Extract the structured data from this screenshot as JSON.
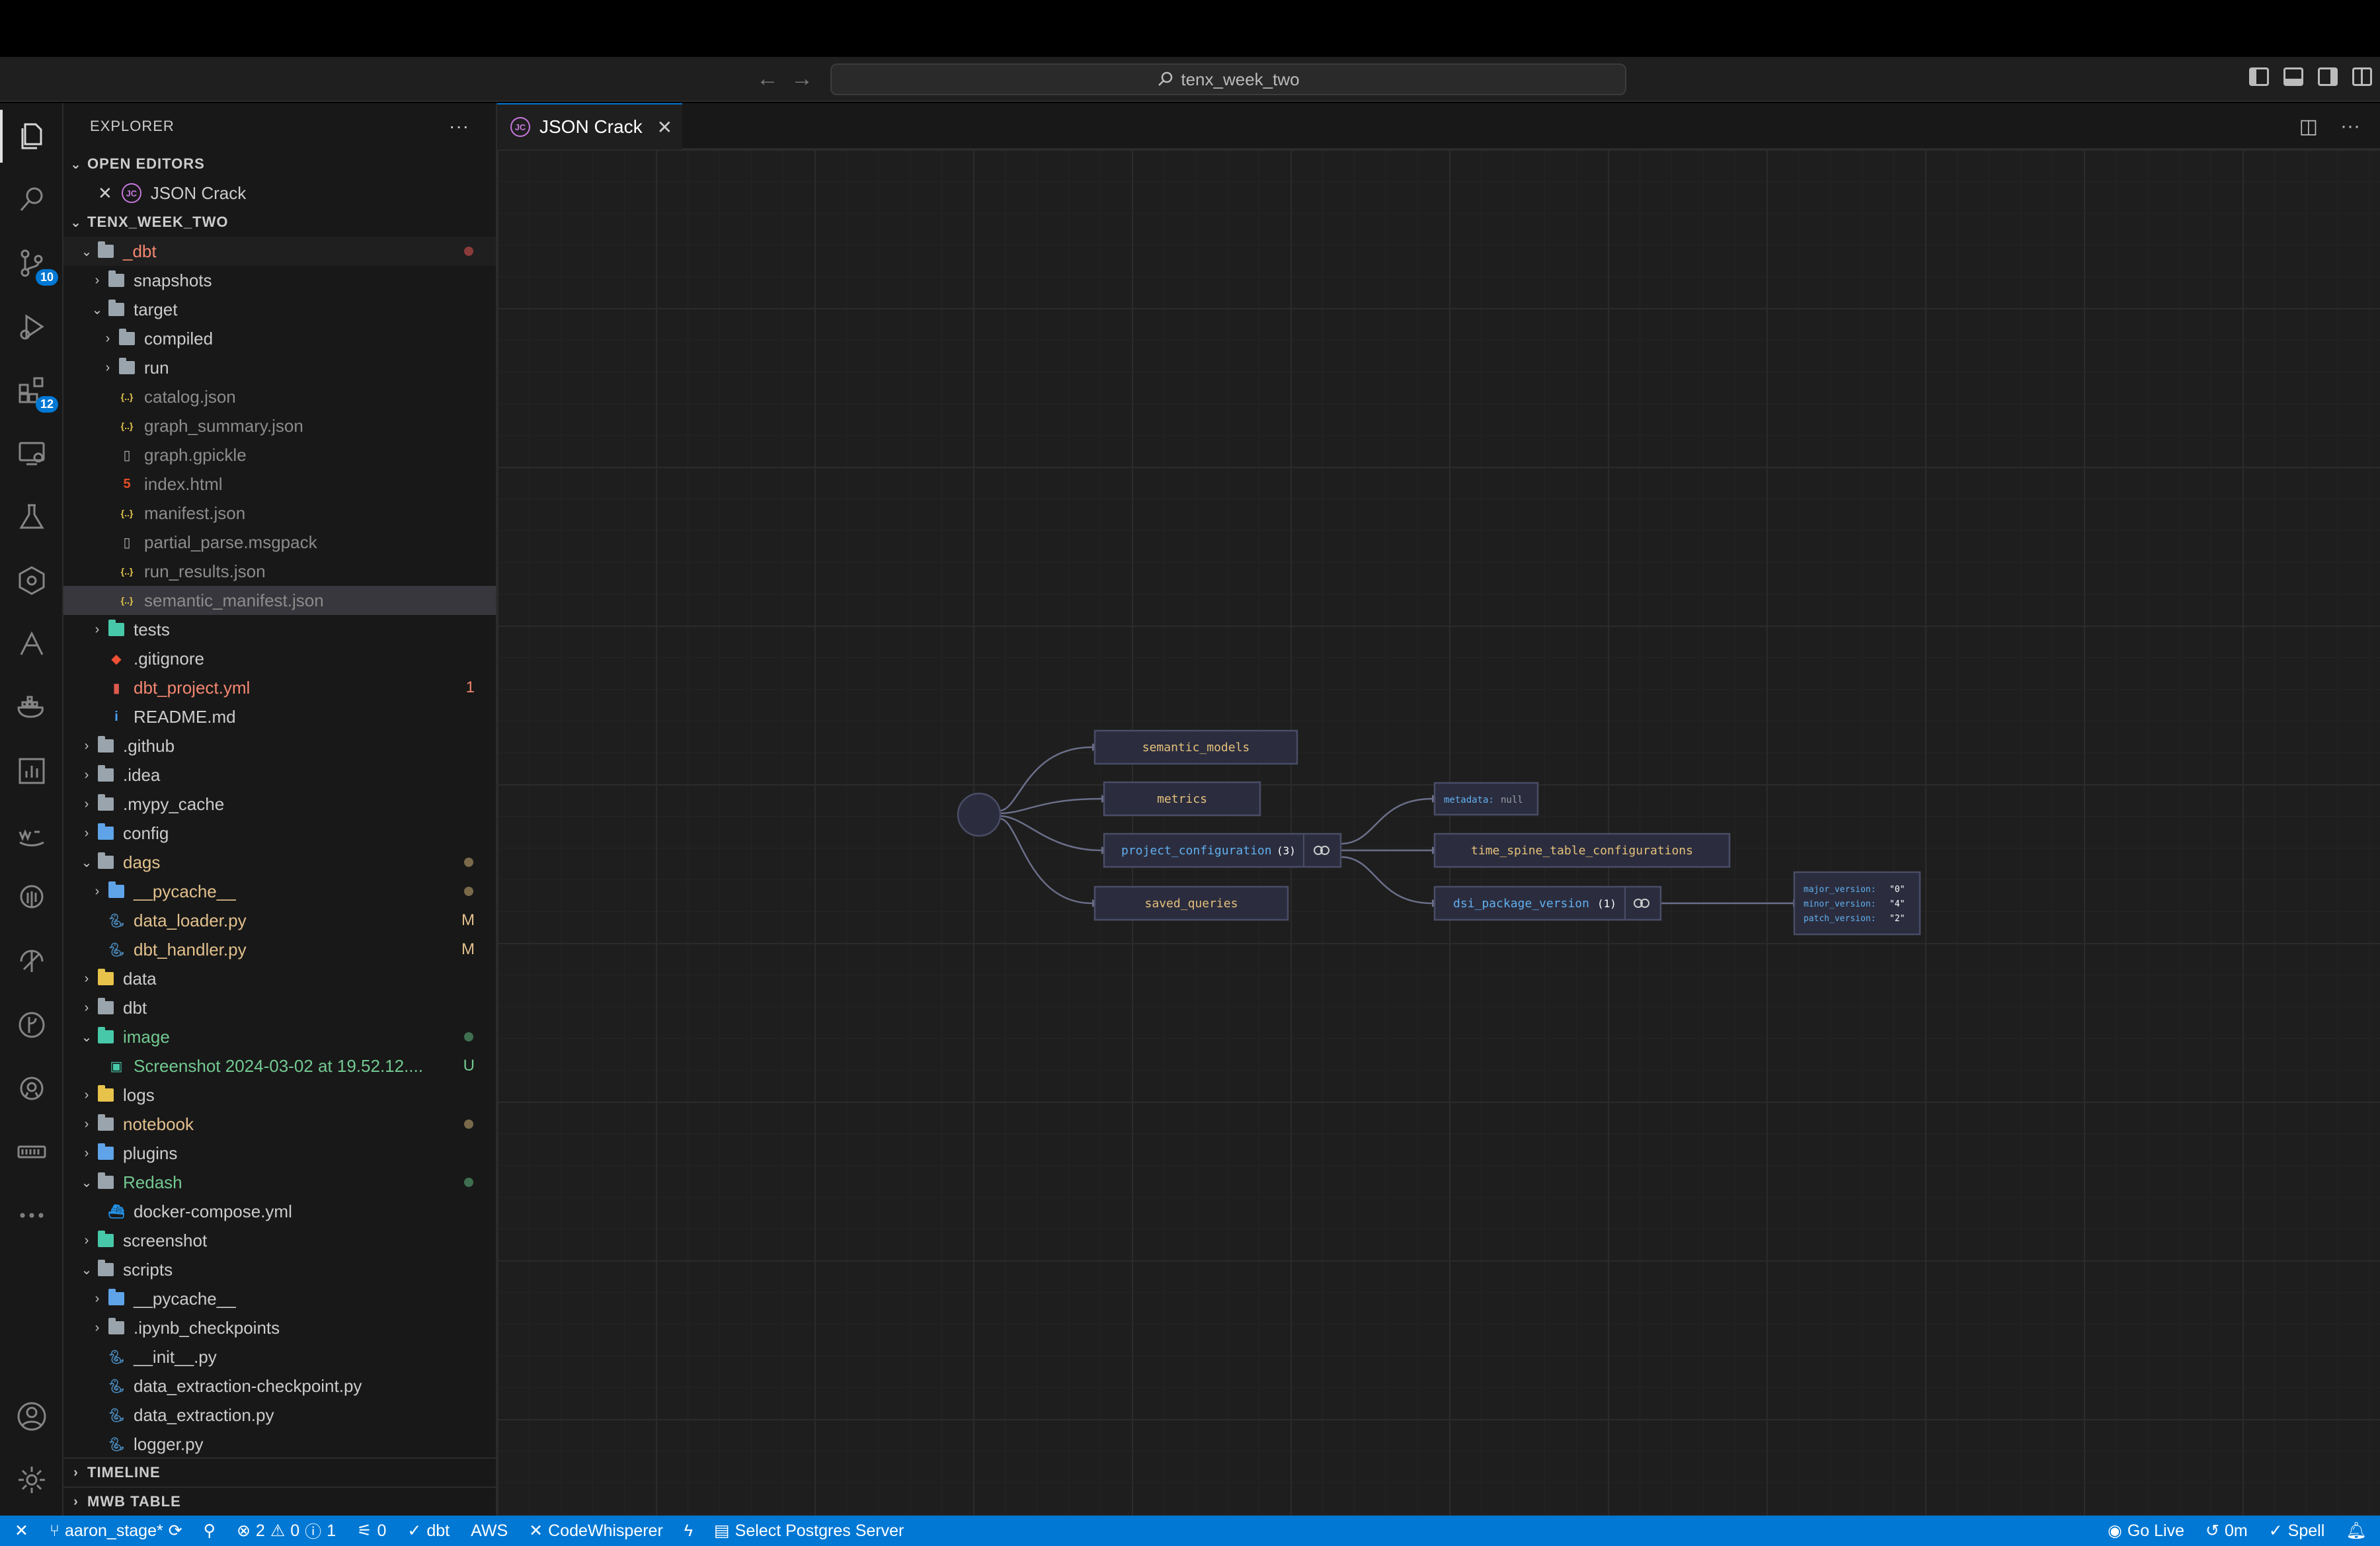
{
  "titlebar": {
    "search_text": "tenx_week_two"
  },
  "activity_badges": {
    "source_control": "10",
    "extensions": "12"
  },
  "sidebar": {
    "title": "EXPLORER",
    "more": "···",
    "open_editors_label": "OPEN EDITORS",
    "open_editor_item": "JSON Crack",
    "workspace_label": "TENX_WEEK_TWO",
    "rows": [
      {
        "label": "_dbt",
        "depth": 1,
        "kind": "folder-open",
        "color": "red",
        "status": "dot-red"
      },
      {
        "label": "snapshots",
        "depth": 2,
        "kind": "folder"
      },
      {
        "label": "target",
        "depth": 2,
        "kind": "folder-open"
      },
      {
        "label": "compiled",
        "depth": 3,
        "kind": "folder"
      },
      {
        "label": "run",
        "depth": 3,
        "kind": "folder"
      },
      {
        "label": "catalog.json",
        "depth": 3,
        "kind": "json",
        "color": "gray"
      },
      {
        "label": "graph_summary.json",
        "depth": 3,
        "kind": "json",
        "color": "gray"
      },
      {
        "label": "graph.gpickle",
        "depth": 3,
        "kind": "file",
        "color": "gray"
      },
      {
        "label": "index.html",
        "depth": 3,
        "kind": "html",
        "color": "gray"
      },
      {
        "label": "manifest.json",
        "depth": 3,
        "kind": "json",
        "color": "gray"
      },
      {
        "label": "partial_parse.msgpack",
        "depth": 3,
        "kind": "file",
        "color": "gray"
      },
      {
        "label": "run_results.json",
        "depth": 3,
        "kind": "json",
        "color": "gray"
      },
      {
        "label": "semantic_manifest.json",
        "depth": 3,
        "kind": "json",
        "color": "gray",
        "selected": true
      },
      {
        "label": "tests",
        "depth": 2,
        "kind": "folder-teal"
      },
      {
        "label": ".gitignore",
        "depth": 2,
        "kind": "git"
      },
      {
        "label": "dbt_project.yml",
        "depth": 2,
        "kind": "yml",
        "color": "red",
        "status": "1"
      },
      {
        "label": "README.md",
        "depth": 2,
        "kind": "info"
      },
      {
        "label": ".github",
        "depth": 1,
        "kind": "folder"
      },
      {
        "label": ".idea",
        "depth": 1,
        "kind": "folder"
      },
      {
        "label": ".mypy_cache",
        "depth": 1,
        "kind": "folder"
      },
      {
        "label": "config",
        "depth": 1,
        "kind": "folder-blue"
      },
      {
        "label": "dags",
        "depth": 1,
        "kind": "folder-open",
        "color": "yellow",
        "status": "dot-gray"
      },
      {
        "label": "__pycache__",
        "depth": 2,
        "kind": "folder-blue",
        "color": "yellow",
        "status": "dot-gray"
      },
      {
        "label": "data_loader.py",
        "depth": 2,
        "kind": "py",
        "color": "yellow",
        "status": "M"
      },
      {
        "label": "dbt_handler.py",
        "depth": 2,
        "kind": "py",
        "color": "yellow",
        "status": "M"
      },
      {
        "label": "data",
        "depth": 1,
        "kind": "folder-yellow"
      },
      {
        "label": "dbt",
        "depth": 1,
        "kind": "folder"
      },
      {
        "label": "image",
        "depth": 1,
        "kind": "folder-open-teal",
        "color": "green",
        "status": "dot-green"
      },
      {
        "label": "Screenshot 2024-03-02 at 19.52.12....",
        "depth": 2,
        "kind": "img",
        "color": "green",
        "status": "U"
      },
      {
        "label": "logs",
        "depth": 1,
        "kind": "folder-yellow"
      },
      {
        "label": "notebook",
        "depth": 1,
        "kind": "folder",
        "color": "yellow",
        "status": "dot-gray"
      },
      {
        "label": "plugins",
        "depth": 1,
        "kind": "folder-blue"
      },
      {
        "label": "Redash",
        "depth": 1,
        "kind": "folder-open",
        "color": "green",
        "status": "dot-green"
      },
      {
        "label": "docker-compose.yml",
        "depth": 2,
        "kind": "docker"
      },
      {
        "label": "screenshot",
        "depth": 1,
        "kind": "folder-teal"
      },
      {
        "label": "scripts",
        "depth": 1,
        "kind": "folder-open"
      },
      {
        "label": "__pycache__",
        "depth": 2,
        "kind": "folder-blue"
      },
      {
        "label": ".ipynb_checkpoints",
        "depth": 2,
        "kind": "folder"
      },
      {
        "label": "__init__.py",
        "depth": 2,
        "kind": "py"
      },
      {
        "label": "data_extraction-checkpoint.py",
        "depth": 2,
        "kind": "py"
      },
      {
        "label": "data_extraction.py",
        "depth": 2,
        "kind": "py"
      },
      {
        "label": "logger.py",
        "depth": 2,
        "kind": "py"
      }
    ],
    "timeline_label": "TIMELINE",
    "mwb_label": "MWB TABLE"
  },
  "editor": {
    "tab_label": "JSON Crack",
    "tab_icon_text": "JC"
  },
  "graph": {
    "nodes": {
      "semantic_models": "semantic_models",
      "metrics": "metrics",
      "project_configuration": "project_configuration",
      "project_configuration_count": "(3)",
      "saved_queries": "saved_queries",
      "metadata_key": "metadata:",
      "metadata_value": "null",
      "time_spine": "time_spine_table_configurations",
      "dsi_package_version": "dsi_package_version",
      "dsi_count": "(1)",
      "major_key": "major_version:",
      "major_val": "\"0\"",
      "minor_key": "minor_version:",
      "minor_val": "\"4\"",
      "patch_key": "patch_version:",
      "patch_val": "\"2\""
    },
    "colors": {
      "key": "#e5c07b",
      "blue": "#61afef",
      "node_bg": "#2b2d3e",
      "node_border": "#4a4d66"
    }
  },
  "statusbar": {
    "branch": "aaron_stage*",
    "errors": "2",
    "warnings": "0",
    "infos": "1",
    "ports": "0",
    "dbt": "dbt",
    "aws": "AWS",
    "codewhisperer": "CodeWhisperer",
    "postgres": "Select Postgres Server",
    "golive": "Go Live",
    "time": "0m",
    "spell": "Spell"
  }
}
